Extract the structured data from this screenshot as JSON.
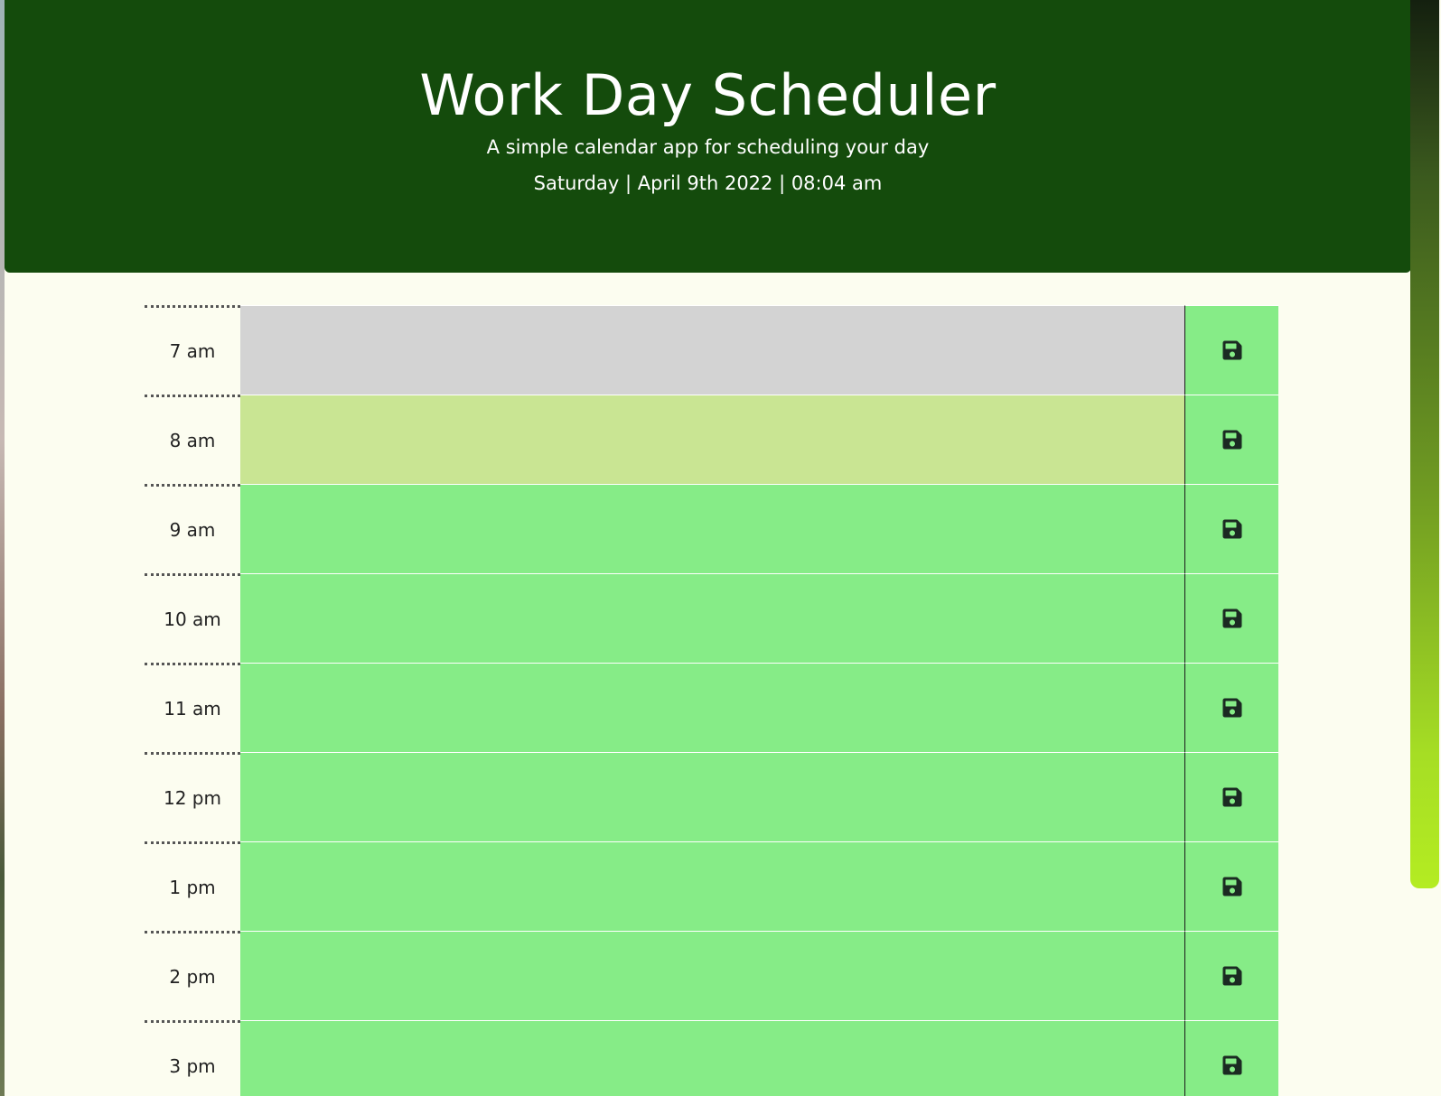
{
  "header": {
    "title": "Work Day Scheduler",
    "subtitle": "A simple calendar app for scheduling your day",
    "current_day": "Saturday | April 9th 2022 | 08:04 am"
  },
  "colors": {
    "header_bg": "#144b0c",
    "page_bg": "#fcfdf0",
    "past": "#d3d3d3",
    "present": "#c9e593",
    "future": "#86ec87",
    "save_button": "#86ec87"
  },
  "save_icon": "floppy-disk-icon",
  "time_blocks": [
    {
      "hour": "7 am",
      "status": "past",
      "text": ""
    },
    {
      "hour": "8 am",
      "status": "present",
      "text": ""
    },
    {
      "hour": "9 am",
      "status": "future",
      "text": ""
    },
    {
      "hour": "10 am",
      "status": "future",
      "text": ""
    },
    {
      "hour": "11 am",
      "status": "future",
      "text": ""
    },
    {
      "hour": "12 pm",
      "status": "future",
      "text": ""
    },
    {
      "hour": "1 pm",
      "status": "future",
      "text": ""
    },
    {
      "hour": "2 pm",
      "status": "future",
      "text": ""
    },
    {
      "hour": "3 pm",
      "status": "future",
      "text": ""
    }
  ]
}
